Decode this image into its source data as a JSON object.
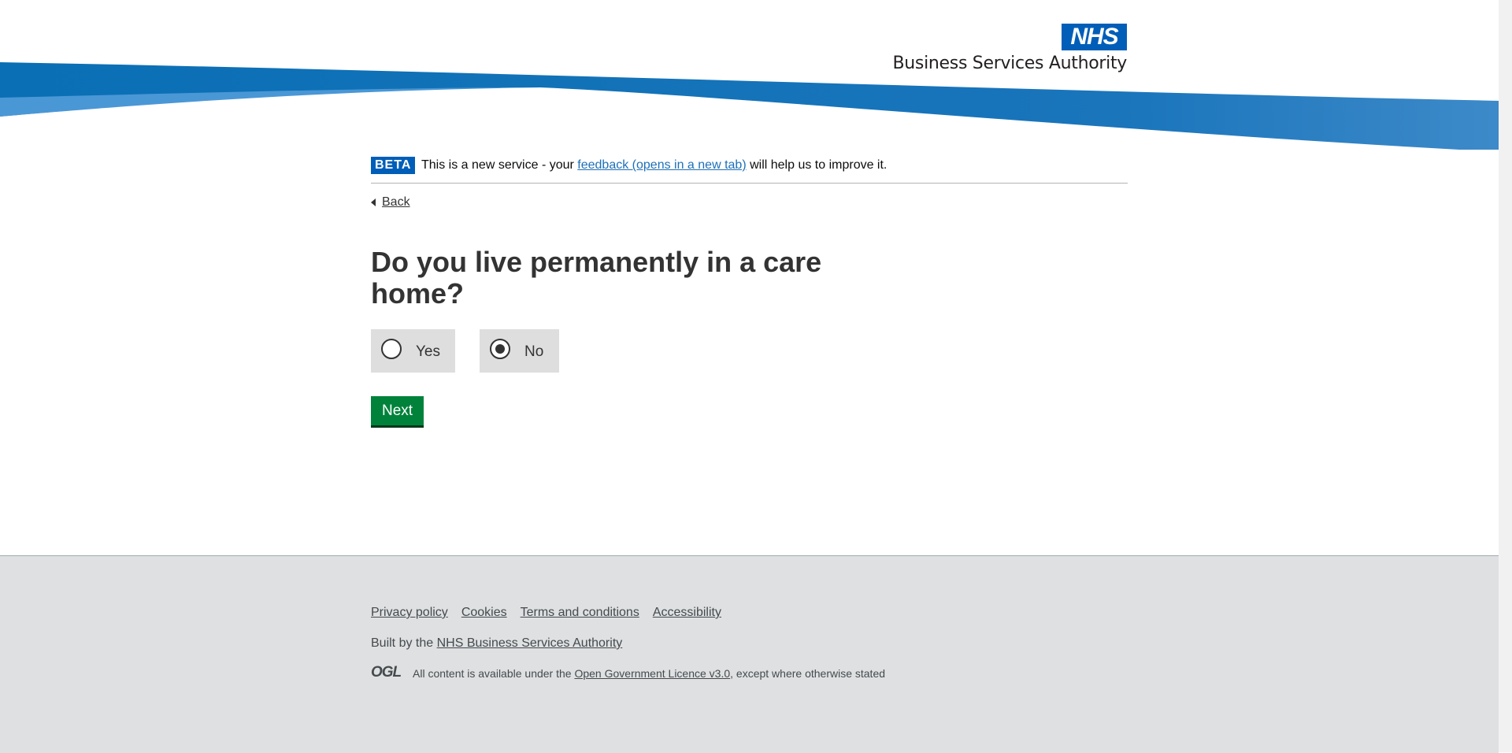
{
  "header": {
    "logo_mark": "NHS",
    "logo_name": "Business Services Authority"
  },
  "phase_banner": {
    "tag": "BETA",
    "text_before": "This is a new service - your ",
    "link": "feedback (opens in a new tab)",
    "text_after": " will help us to improve it."
  },
  "back_link": "Back",
  "question": "Do you live permanently in a care home?",
  "options": [
    {
      "label": "Yes",
      "selected": false
    },
    {
      "label": "No",
      "selected": true
    }
  ],
  "next_button": "Next",
  "footer": {
    "links": [
      "Privacy policy",
      "Cookies",
      "Terms and conditions",
      "Accessibility"
    ],
    "built_by_prefix": "Built by the ",
    "built_by_link": "NHS Business Services Authority",
    "licence_logo": "OGL",
    "licence_prefix": "All content is available under the ",
    "licence_link": "Open Government Licence v3.0",
    "licence_suffix": ", except where otherwise stated"
  },
  "colors": {
    "nhs_blue": "#005eb8",
    "button_green": "#00823b",
    "footer_grey": "#dee0e2",
    "link_blue": "#1d70b8"
  }
}
